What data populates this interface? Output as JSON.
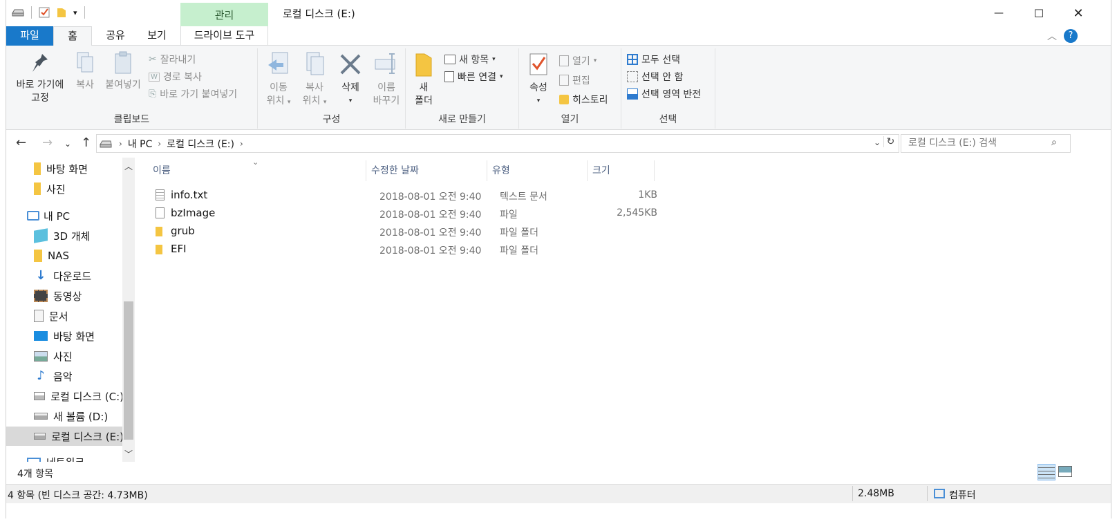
{
  "window": {
    "title": "로컬 디스크 (E:)",
    "context_tab": "관리",
    "minimize": "—",
    "maximize": "☐",
    "close": "✕"
  },
  "tabs": {
    "file": "파일",
    "home": "홈",
    "share": "공유",
    "view": "보기",
    "drive_tools": "드라이브 도구"
  },
  "ribbon": {
    "clipboard": {
      "label": "클립보드",
      "pin_line1": "바로 가기에",
      "pin_line2": "고정",
      "copy": "복사",
      "paste": "붙여넣기",
      "cut": "잘라내기",
      "copy_path": "경로 복사",
      "paste_shortcut": "바로 가기 붙여넣기"
    },
    "organize": {
      "label": "구성",
      "move_line1": "이동",
      "move_line2": "위치",
      "copyto_line1": "복사",
      "copyto_line2": "위치",
      "delete": "삭제",
      "rename_line1": "이름",
      "rename_line2": "바꾸기"
    },
    "new": {
      "label": "새로 만들기",
      "folder_line1": "새",
      "folder_line2": "폴더",
      "new_item": "새 항목",
      "easy_access": "빠른 연결"
    },
    "open": {
      "label": "열기",
      "properties": "속성",
      "open": "열기",
      "edit": "편집",
      "history": "히스토리"
    },
    "select": {
      "label": "선택",
      "select_all": "모두 선택",
      "select_none": "선택 안 함",
      "invert": "선택 영역 반전"
    }
  },
  "address": {
    "crumbs": [
      "내 PC",
      "로컬 디스크 (E:)"
    ],
    "search_placeholder": "로컬 디스크 (E:) 검색"
  },
  "nav": {
    "items": [
      {
        "label": "바탕 화면",
        "icon": "folder-icon"
      },
      {
        "label": "사진",
        "icon": "folder-icon"
      },
      {
        "label": "내 PC",
        "icon": "computer-icon"
      },
      {
        "label": "3D 개체",
        "icon": "cube-icon"
      },
      {
        "label": "NAS",
        "icon": "folder-icon"
      },
      {
        "label": "다운로드",
        "icon": "download-icon"
      },
      {
        "label": "동영상",
        "icon": "video-icon"
      },
      {
        "label": "문서",
        "icon": "document-icon"
      },
      {
        "label": "바탕 화면",
        "icon": "desktop-icon"
      },
      {
        "label": "사진",
        "icon": "pictures-icon"
      },
      {
        "label": "음악",
        "icon": "music-icon"
      },
      {
        "label": "로컬 디스크 (C:)",
        "icon": "windows-drive-icon"
      },
      {
        "label": "새 볼륨 (D:)",
        "icon": "drive-icon"
      },
      {
        "label": "로컬 디스크 (E:)",
        "icon": "drive-icon"
      },
      {
        "label": "네트워크",
        "icon": "network-icon"
      }
    ]
  },
  "columns": {
    "name": "이름",
    "modified": "수정한 날짜",
    "type": "유형",
    "size": "크기"
  },
  "files": [
    {
      "name": "info.txt",
      "modified": "2018-08-01 오전 9:40",
      "type": "텍스트 문서",
      "size": "1KB",
      "icon": "text-file-icon"
    },
    {
      "name": "bzImage",
      "modified": "2018-08-01 오전 9:40",
      "type": "파일",
      "size": "2,545KB",
      "icon": "file-icon"
    },
    {
      "name": "grub",
      "modified": "2018-08-01 오전 9:40",
      "type": "파일 폴더",
      "size": "",
      "icon": "folder-icon"
    },
    {
      "name": "EFI",
      "modified": "2018-08-01 오전 9:40",
      "type": "파일 폴더",
      "size": "",
      "icon": "folder-icon"
    }
  ],
  "status": {
    "count": "4개 항목",
    "bottom_left": "4 항목 (빈 디스크 공간: 4.73MB)",
    "bottom_size": "2.48MB",
    "bottom_location": "컴퓨터"
  }
}
